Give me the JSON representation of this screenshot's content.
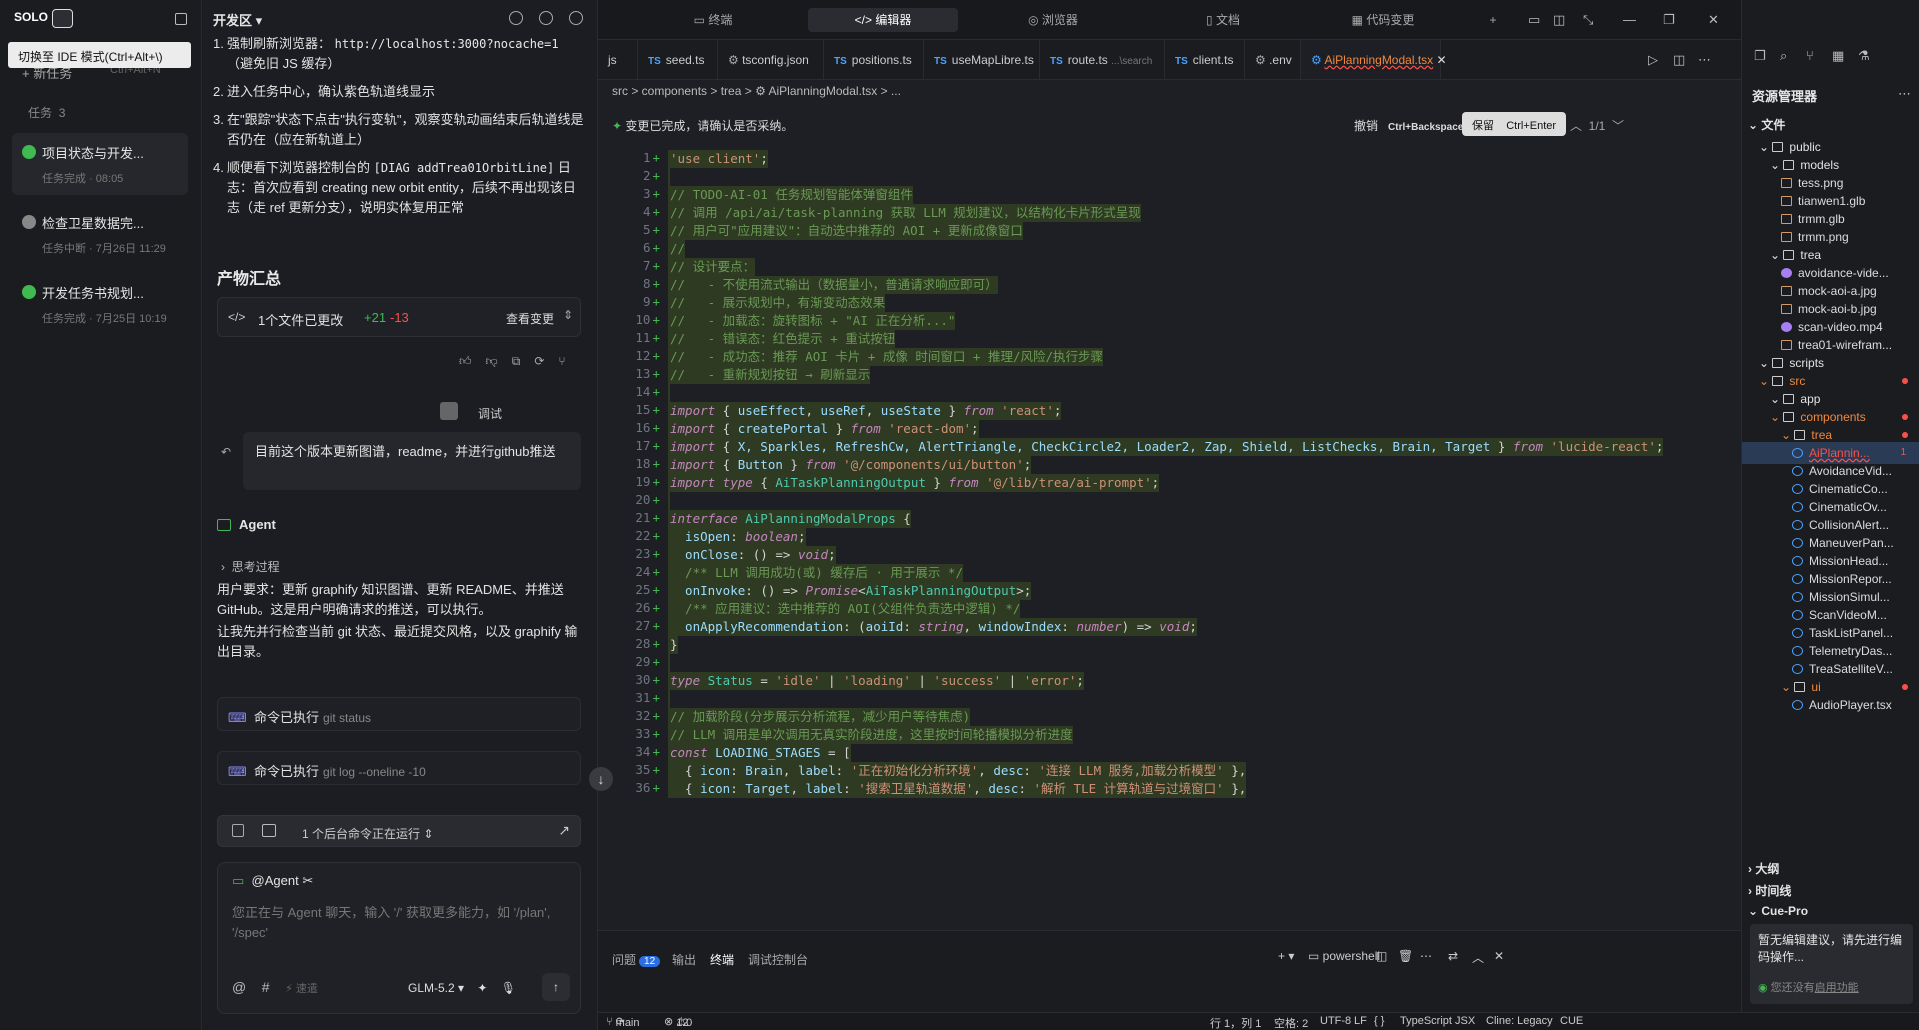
{
  "left": {
    "brand": "SOLO",
    "tooltip": "切换至 IDE 模式(Ctrl+Alt+\\)",
    "new_task": "新任务",
    "new_task_shortcut": "Ctrl+Alt+N",
    "tasks_label": "任务",
    "tasks_count": "3",
    "tasks": [
      {
        "title": "项目状态与开发...",
        "status": "任务完成 · 08:05",
        "state_color": "#3fb950"
      },
      {
        "title": "检查卫星数据完...",
        "status": "任务中断 · 7月26日 11:29",
        "state_color": "#888888"
      },
      {
        "title": "开发任务书规划...",
        "status": "任务完成 · 7月25日 10:19",
        "state_color": "#3fb950"
      }
    ]
  },
  "chat": {
    "title": "开发区",
    "steps": [
      {
        "n": "1.",
        "text": "强制刷新浏览器：",
        "code": "http://localhost:3000?nocache=1",
        "tail": "（避免旧 JS 缓存）"
      },
      {
        "n": "2.",
        "text": "进入任务中心，确认紫色轨道线显示",
        "code": "",
        "tail": ""
      },
      {
        "n": "3.",
        "text": "在\"跟踪\"状态下点击\"执行变轨\"，观察变轨动画结束后轨道线是否仍在（应在新轨道上）",
        "code": "",
        "tail": ""
      },
      {
        "n": "4.",
        "text": "顺便看下浏览器控制台的",
        "code": "[DIAG addTrea01OrbitLine]",
        "tail": "日志：首次应看到 creating new orbit entity，后续不再出现该日志（走 ref 更新分支），说明实体复用正常"
      }
    ],
    "artifacts_title": "产物汇总",
    "changes_label": "1个文件已更改",
    "adds": "+21",
    "dels": "-13",
    "view_changes": "查看变更",
    "user_name": "调试",
    "user_message": "目前这个版本更新图谱，readme，并进行github推送",
    "agent_label": "Agent",
    "thinking": "思考过程",
    "para1": "用户要求：更新 graphify 知识图谱、更新 README、并推送 GitHub。这是用户明确请求的推送，可以执行。",
    "para2": "让我先并行检查当前 git 状态、最近提交风格，以及 graphify 输出目录。",
    "cmd_done": "命令已执行",
    "cmd1": "git status",
    "cmd2": "git log --oneline -10",
    "bg_running": "1 个后台命令正在运行",
    "at_agent": "@Agent",
    "input_placeholder": "您正在与 Agent 聊天，输入 '/' 获取更多能力，如 '/plan', '/spec'",
    "speed": "速遣",
    "model": "GLM-5.2"
  },
  "editor": {
    "top_tabs": [
      "终端",
      "编辑器",
      "浏览器",
      "文档",
      "代码变更"
    ],
    "active_top_tab": "编辑器",
    "file_tabs": [
      {
        "name": "js",
        "ts": false
      },
      {
        "name": "seed.ts",
        "ts": true
      },
      {
        "name": "tsconfig.json",
        "ts": false
      },
      {
        "name": "positions.ts",
        "ts": true
      },
      {
        "name": "useMapLibre.ts",
        "ts": true
      },
      {
        "name": "route.ts",
        "ts": true,
        "hint": "...\\search"
      },
      {
        "name": "client.ts",
        "ts": true
      },
      {
        "name": ".env",
        "ts": false
      },
      {
        "name": "AiPlanningModal.tsx",
        "ts": false
      }
    ],
    "breadcrumb": "src  >  components  >  trea  >  ⚙ AiPlanningModal.tsx  >  ...",
    "accept_msg": "变更已完成，请确认是否采纳。",
    "undo": "撤销",
    "undo_sc": "Ctrl+Backspace",
    "keep": "保留",
    "keep_sc": "Ctrl+Enter",
    "change_count": "1/1",
    "bottom_tabs": [
      "问题",
      "输出",
      "终端",
      "调试控制台"
    ],
    "problem_count": "12",
    "shell": "powershell"
  },
  "code_lines": [
    {
      "n": "1",
      "h": true,
      "html": "<span class='s'>'use client'</span><span class='pl'>;</span>"
    },
    {
      "n": "2",
      "h": true,
      "html": ""
    },
    {
      "n": "3",
      "h": true,
      "html": "<span class='cm'>// TODO-AI-01 任务规划智能体弹窗组件</span>"
    },
    {
      "n": "4",
      "h": true,
      "html": "<span class='cm'>// 调用 /api/ai/task-planning 获取 LLM 规划建议，以结构化卡片形式呈现</span>"
    },
    {
      "n": "5",
      "h": true,
      "html": "<span class='cm'>// 用户可\"应用建议\"：自动选中推荐的 AOI + 更新成像窗口</span>"
    },
    {
      "n": "6",
      "h": true,
      "html": "<span class='cm'>//</span>"
    },
    {
      "n": "7",
      "h": true,
      "html": "<span class='cm'>// 设计要点：</span>"
    },
    {
      "n": "8",
      "h": true,
      "html": "<span class='cm'>//   - 不使用流式输出（数据量小，普通请求响应即可）</span>"
    },
    {
      "n": "9",
      "h": true,
      "html": "<span class='cm'>//   - 展示规划中，有渐变动态效果</span>"
    },
    {
      "n": "10",
      "h": true,
      "html": "<span class='cm'>//   - 加载态：旋转图标 + \"AI 正在分析...\"</span>"
    },
    {
      "n": "11",
      "h": true,
      "html": "<span class='cm'>//   - 错误态：红色提示 + 重试按钮</span>"
    },
    {
      "n": "12",
      "h": true,
      "html": "<span class='cm'>//   - 成功态：推荐 AOI 卡片 + 成像 时间窗口 + 推理/风险/执行步骤</span>"
    },
    {
      "n": "13",
      "h": true,
      "html": "<span class='cm'>//   - 重新规划按钮 → 刷新显示</span>"
    },
    {
      "n": "14",
      "h": true,
      "html": ""
    },
    {
      "n": "15",
      "h": true,
      "html": "<span class='k'>import</span><span class='pl'> { </span><span class='v'>useEffect</span><span class='pl'>, </span><span class='v'>useRef</span><span class='pl'>, </span><span class='v'>useState</span><span class='pl'> } </span><span class='k'>from</span><span class='s'> 'react'</span><span class='pl'>;</span>"
    },
    {
      "n": "16",
      "h": true,
      "html": "<span class='k'>import</span><span class='pl'> { </span><span class='v'>createPortal</span><span class='pl'> } </span><span class='k'>from</span><span class='s'> 'react-dom'</span><span class='pl'>;</span>"
    },
    {
      "n": "17",
      "h": true,
      "html": "<span class='k'>import</span><span class='pl'> { </span><span class='v'>X, Sparkles, RefreshCw, AlertTriangle, CheckCircle2, Loader2, Zap, Shield, ListChecks, Brain, Target</span><span class='pl'> } </span><span class='k'>from</span><span class='s'> 'lucide-react'</span><span class='pl'>;</span>"
    },
    {
      "n": "18",
      "h": true,
      "html": "<span class='k'>import</span><span class='pl'> { </span><span class='v'>Button</span><span class='pl'> } </span><span class='k'>from</span><span class='s'> '@/components/ui/button'</span><span class='pl'>;</span>"
    },
    {
      "n": "19",
      "h": true,
      "html": "<span class='k'>import type</span><span class='pl'> { </span><span class='ty'>AiTaskPlanningOutput</span><span class='pl'> } </span><span class='k'>from</span><span class='s'> '@/lib/trea/ai-prompt'</span><span class='pl'>;</span>"
    },
    {
      "n": "20",
      "h": true,
      "html": ""
    },
    {
      "n": "21",
      "h": true,
      "html": "<span class='k'>interface</span><span class='ty'> AiPlanningModalProps</span><span class='pl'> {</span>"
    },
    {
      "n": "22",
      "h": true,
      "html": "<span class='v'>  isOpen</span><span class='pl'>: </span><span class='k'>boolean</span><span class='pl'>;</span>"
    },
    {
      "n": "23",
      "h": true,
      "html": "<span class='v'>  onClose</span><span class='pl'>: () => </span><span class='k'>void</span><span class='pl'>;</span>"
    },
    {
      "n": "24",
      "h": true,
      "html": "<span class='cm'>  /** LLM 调用成功(或) 缓存后 · 用于展示 */</span>"
    },
    {
      "n": "25",
      "h": true,
      "html": "<span class='v'>  onInvoke</span><span class='pl'>: () => </span><span class='k'>Promise</span><span class='pl'>&lt;</span><span class='ty'>AiTaskPlanningOutput</span><span class='pl'>&gt;;</span>"
    },
    {
      "n": "26",
      "h": true,
      "html": "<span class='cm'>  /** 应用建议：选中推荐的 AOI(父组件负责选中逻辑) */</span>"
    },
    {
      "n": "27",
      "h": true,
      "html": "<span class='v'>  onApplyRecommendation</span><span class='pl'>: (</span><span class='v'>aoiId</span><span class='pl'>: </span><span class='k'>string</span><span class='pl'>, </span><span class='v'>windowIndex</span><span class='pl'>: </span><span class='k'>number</span><span class='pl'>) => </span><span class='k'>void</span><span class='pl'>;</span>"
    },
    {
      "n": "28",
      "h": true,
      "html": "<span class='pl'>}</span>"
    },
    {
      "n": "29",
      "h": true,
      "html": ""
    },
    {
      "n": "30",
      "h": true,
      "html": "<span class='k'>type</span><span class='ty'> Status</span><span class='pl'> = </span><span class='s'>'idle'</span><span class='pl'> | </span><span class='s'>'loading'</span><span class='pl'> | </span><span class='s'>'success'</span><span class='pl'> | </span><span class='s'>'error'</span><span class='pl'>;</span>"
    },
    {
      "n": "31",
      "h": true,
      "html": ""
    },
    {
      "n": "32",
      "h": true,
      "html": "<span class='cm'>// 加载阶段(分步展示分析流程，减少用户等待焦虑)</span>"
    },
    {
      "n": "33",
      "h": true,
      "html": "<span class='cm'>// LLM 调用是单次调用无真实阶段进度，这里按时间轮播模拟分析进度</span>"
    },
    {
      "n": "34",
      "h": true,
      "html": "<span class='k'>const</span><span class='v'> LOADING_STAGES</span><span class='pl'> = [</span>"
    },
    {
      "n": "35",
      "h": true,
      "html": "<span class='pl'>  { </span><span class='v'>icon</span><span class='pl'>: </span><span class='v'>Brain</span><span class='pl'>, </span><span class='v'>label</span><span class='pl'>: </span><span class='s'>'正在初始化分析环境'</span><span class='pl'>, </span><span class='v'>desc</span><span class='pl'>: </span><span class='s'>'连接 LLM 服务,加载分析模型'</span><span class='pl'> },</span>"
    },
    {
      "n": "36",
      "h": true,
      "html": "<span class='pl'>  { </span><span class='v'>icon</span><span class='pl'>: </span><span class='v'>Target</span><span class='pl'>, </span><span class='v'>label</span><span class='pl'>: </span><span class='s'>'搜索卫星轨道数据'</span><span class='pl'>, </span><span class='v'>desc</span><span class='pl'>: </span><span class='s'>'解析 TLE 计算轨道与过境窗口'</span><span class='pl'> },</span>"
    }
  ],
  "explorer": {
    "title": "资源管理器",
    "files_label": "文件",
    "nodes": [
      {
        "label": "public",
        "lvl": 1,
        "kind": "dir"
      },
      {
        "label": "models",
        "lvl": 2,
        "kind": "dir"
      },
      {
        "label": "tess.png",
        "lvl": 3,
        "kind": "img"
      },
      {
        "label": "tianwen1.glb",
        "lvl": 3,
        "kind": "file"
      },
      {
        "label": "trmm.glb",
        "lvl": 3,
        "kind": "file"
      },
      {
        "label": "trmm.png",
        "lvl": 3,
        "kind": "img"
      },
      {
        "label": "trea",
        "lvl": 2,
        "kind": "dir"
      },
      {
        "label": "avoidance-vide...",
        "lvl": 3,
        "kind": "vid"
      },
      {
        "label": "mock-aoi-a.jpg",
        "lvl": 3,
        "kind": "img"
      },
      {
        "label": "mock-aoi-b.jpg",
        "lvl": 3,
        "kind": "img"
      },
      {
        "label": "scan-video.mp4",
        "lvl": 3,
        "kind": "vid"
      },
      {
        "label": "trea01-wirefram...",
        "lvl": 3,
        "kind": "img"
      },
      {
        "label": "scripts",
        "lvl": 1,
        "kind": "dir"
      },
      {
        "label": "src",
        "lvl": 1,
        "kind": "dir",
        "hot": true
      },
      {
        "label": "app",
        "lvl": 2,
        "kind": "dir"
      },
      {
        "label": "components",
        "lvl": 2,
        "kind": "dir",
        "hot": true
      },
      {
        "label": "trea",
        "lvl": 3,
        "kind": "dir",
        "hot": true
      },
      {
        "label": "AiPlannin...",
        "lvl": 4,
        "kind": "ts",
        "sel": true,
        "badge": "1"
      },
      {
        "label": "AvoidanceVid...",
        "lvl": 4,
        "kind": "ts"
      },
      {
        "label": "CinematicCo...",
        "lvl": 4,
        "kind": "ts"
      },
      {
        "label": "CinematicOv...",
        "lvl": 4,
        "kind": "ts"
      },
      {
        "label": "CollisionAlert...",
        "lvl": 4,
        "kind": "ts"
      },
      {
        "label": "ManeuverPan...",
        "lvl": 4,
        "kind": "ts"
      },
      {
        "label": "MissionHead...",
        "lvl": 4,
        "kind": "ts"
      },
      {
        "label": "MissionRepor...",
        "lvl": 4,
        "kind": "ts"
      },
      {
        "label": "MissionSimul...",
        "lvl": 4,
        "kind": "ts"
      },
      {
        "label": "ScanVideoM...",
        "lvl": 4,
        "kind": "ts"
      },
      {
        "label": "TaskListPanel...",
        "lvl": 4,
        "kind": "ts"
      },
      {
        "label": "TelemetryDas...",
        "lvl": 4,
        "kind": "ts"
      },
      {
        "label": "TreaSatelliteV...",
        "lvl": 4,
        "kind": "ts"
      },
      {
        "label": "ui",
        "lvl": 3,
        "kind": "dir",
        "hot": true
      },
      {
        "label": "AudioPlayer.tsx",
        "lvl": 4,
        "kind": "ts"
      }
    ],
    "outline": "大纲",
    "timeline": "时间线",
    "cue_pro": "Cue-Pro",
    "cue_msg": "暂无编辑建议，请先进行编码操作...",
    "cue_link_pre": "您还没有",
    "cue_link": "启用功能"
  },
  "status": {
    "branch": "main",
    "errors": "12",
    "warnings": "0",
    "cursor": "行 1，列 1",
    "spaces": "空格: 2",
    "encoding": "UTF-8",
    "eol": "LF",
    "lang": "TypeScript JSX",
    "cline": "Cline: Legacy",
    "cue": "CUE"
  }
}
